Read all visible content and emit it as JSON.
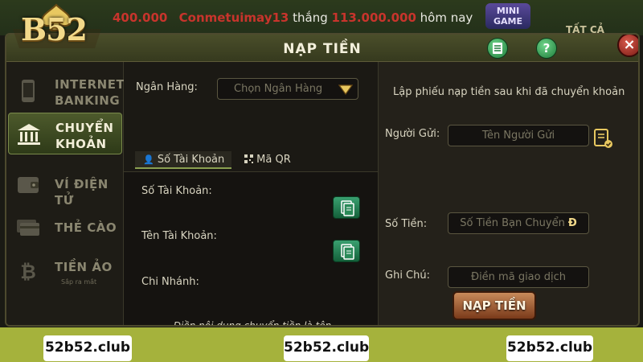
{
  "logo": {
    "text": "B52"
  },
  "ticker": {
    "amount_left": "400.000",
    "user": "Conmetuimay13",
    "verb": "thắng",
    "amount": "113.000.000",
    "suffix": "hôm nay"
  },
  "mini_game": {
    "line1": "MINI",
    "line2": "GAME"
  },
  "all_label": "TẤT CẢ",
  "dialog": {
    "title": "NẠP TIỀN",
    "doc_icon": "document-icon",
    "help_label": "?",
    "close_label": "×"
  },
  "sidebar": {
    "items": [
      {
        "id": "internet-banking",
        "line1": "INTERNET",
        "line2": "BANKING",
        "icon": "phone-icon",
        "active": false
      },
      {
        "id": "chuyen-khoan",
        "line1": "CHUYỂN",
        "line2": "KHOẢN",
        "icon": "bank-icon",
        "active": true
      },
      {
        "id": "vi-dien-tu",
        "line1": "VÍ ĐIỆN TỬ",
        "line2": "",
        "icon": "wallet-icon",
        "active": false
      },
      {
        "id": "the-cao",
        "line1": "THẺ CÀO",
        "line2": "",
        "icon": "card-icon",
        "active": false
      },
      {
        "id": "tien-ao",
        "line1": "TIỀN ẢO",
        "line2": "",
        "sub": "Sắp ra mắt",
        "icon": "bitcoin-icon",
        "active": false
      }
    ]
  },
  "bank": {
    "label": "Ngân Hàng:",
    "placeholder": "Chọn Ngân Hàng"
  },
  "tabs": {
    "account": "Số Tài Khoản",
    "qr": "Mã QR"
  },
  "details": {
    "account_number": "Số Tài Khoản:",
    "account_name": "Tên Tài Khoản:",
    "branch": "Chi Nhánh:",
    "note": "Điền nội dung chuyển tiền là tên chủ tài khoản người gửi."
  },
  "form": {
    "instruction": "Lập phiếu nạp tiền sau khi đã chuyển khoản",
    "sender_label": "Người Gửi:",
    "sender_placeholder": "Tên Người Gửi",
    "amount_label": "Số Tiền:",
    "amount_placeholder": "Số Tiền Bạn Chuyển",
    "currency_symbol": "Đ",
    "memo_label": "Ghi Chú:",
    "memo_placeholder": "Điền mã giao dịch",
    "submit": "NẠP TIỀN"
  },
  "watermarks": [
    "52b52.club",
    "52b52.club",
    "52b52.club"
  ],
  "colors": {
    "accent_green": "#8aa050",
    "title_bar": "#4a4e2a",
    "submit_button": "#a2623a",
    "watermark_bar": "#a5b23c"
  }
}
